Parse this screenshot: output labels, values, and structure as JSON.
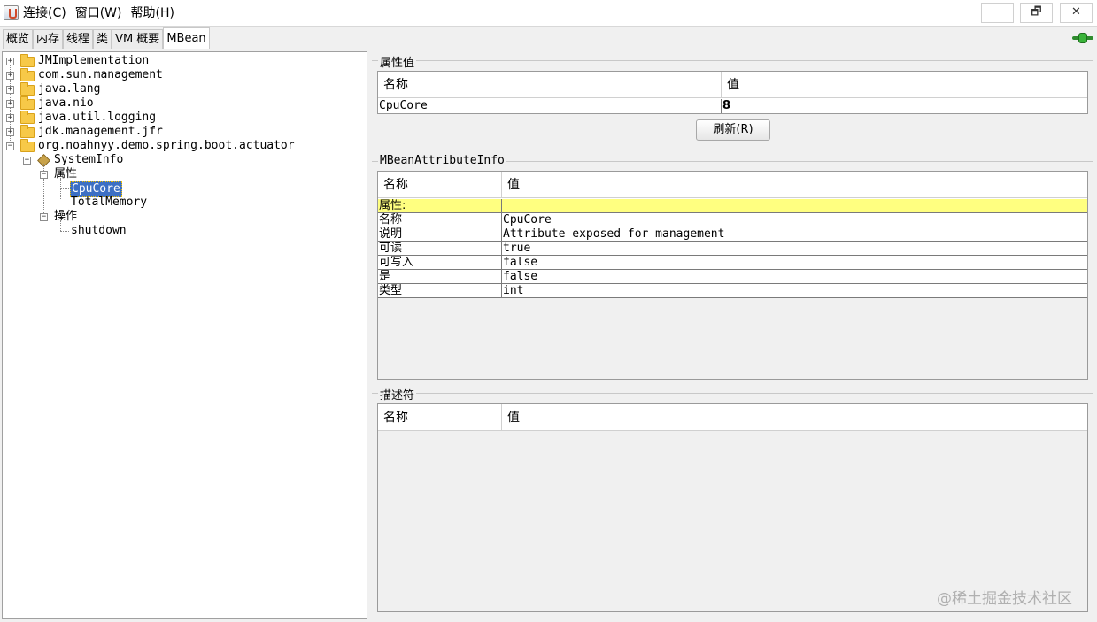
{
  "menu": [
    "连接(C)",
    "窗口(W)",
    "帮助(H)"
  ],
  "window_buttons": {
    "minimize": "–",
    "restore": "🗗",
    "close": "✕"
  },
  "tabs": [
    "概览",
    "内存",
    "线程",
    "类",
    "VM 概要",
    "MBean"
  ],
  "active_tab": "MBean",
  "tree": {
    "domains": [
      "JMImplementation",
      "com.sun.management",
      "java.lang",
      "java.nio",
      "java.util.logging",
      "jdk.management.jfr",
      "org.noahnyy.demo.spring.boot.actuator"
    ],
    "bean": "SystemInfo",
    "attributes_label": "属性",
    "attributes": [
      "CpuCore",
      "TotalMemory"
    ],
    "operations_label": "操作",
    "operations": [
      "shutdown"
    ],
    "selected": "CpuCore"
  },
  "attr_value": {
    "title": "属性值",
    "columns": [
      "名称",
      "值"
    ],
    "rows": [
      {
        "name": "CpuCore",
        "value": "8"
      }
    ],
    "refresh_label": "刷新(R)"
  },
  "attr_info": {
    "title": "MBeanAttributeInfo",
    "columns": [
      "名称",
      "值"
    ],
    "section_label": "属性:",
    "rows": [
      {
        "name": "名称",
        "value": "CpuCore"
      },
      {
        "name": "说明",
        "value": "Attribute exposed for management"
      },
      {
        "name": "可读",
        "value": "true"
      },
      {
        "name": "可写入",
        "value": "false"
      },
      {
        "name": "是",
        "value": "false"
      },
      {
        "name": "类型",
        "value": "int"
      }
    ]
  },
  "descriptor": {
    "title": "描述符",
    "columns": [
      "名称",
      "值"
    ]
  },
  "watermark": "@稀土掘金技术社区"
}
